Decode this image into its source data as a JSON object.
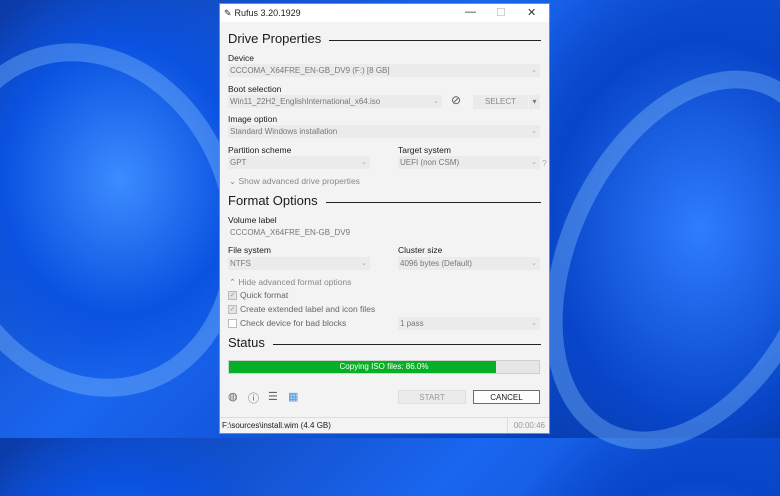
{
  "window": {
    "title": "Rufus 3.20.1929"
  },
  "drive": {
    "heading": "Drive Properties",
    "device_label": "Device",
    "device_value": "CCCOMA_X64FRE_EN-GB_DV9 (F:) [8 GB]",
    "boot_label": "Boot selection",
    "boot_value": "Win11_22H2_EnglishInternational_x64.iso",
    "select_button": "SELECT",
    "image_label": "Image option",
    "image_value": "Standard Windows installation",
    "partition_label": "Partition scheme",
    "partition_value": "GPT",
    "target_label": "Target system",
    "target_value": "UEFI (non CSM)",
    "help": "?",
    "advanced_toggle": "Show advanced drive properties"
  },
  "format": {
    "heading": "Format Options",
    "volume_label": "Volume label",
    "volume_value": "CCCOMA_X64FRE_EN-GB_DV9",
    "fs_label": "File system",
    "fs_value": "NTFS",
    "cluster_label": "Cluster size",
    "cluster_value": "4096 bytes (Default)",
    "advanced_toggle": "Hide advanced format options",
    "quick_format": "Quick format",
    "extended_label": "Create extended label and icon files",
    "bad_blocks": "Check device for bad blocks",
    "passes": "1 pass"
  },
  "status": {
    "heading": "Status",
    "progress_text": "Copying ISO files: 86.0%",
    "progress_percent": 86,
    "progress_color": "#06b025"
  },
  "buttons": {
    "start": "START",
    "cancel": "CANCEL"
  },
  "statusbar": {
    "file": "F:\\sources\\install.wim (4.4 GB)",
    "elapsed": "00:00:46"
  }
}
